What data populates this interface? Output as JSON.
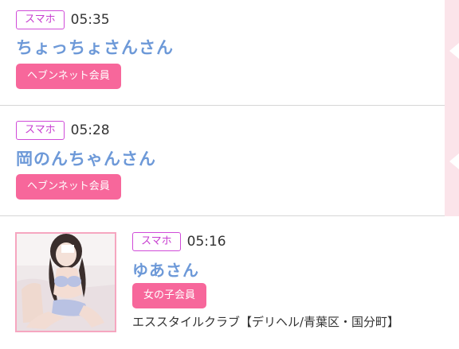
{
  "entries": [
    {
      "device": "スマホ",
      "time": "05:35",
      "name": "ちょっちょさんさん",
      "member": "ヘブンネット会員"
    },
    {
      "device": "スマホ",
      "time": "05:28",
      "name": "岡のんちゃんさん",
      "member": "ヘブンネット会員"
    },
    {
      "device": "スマホ",
      "time": "05:16",
      "name": "ゆあさん",
      "member": "女の子会員",
      "shop": "エススタイルクラブ【デリヘル/青葉区・国分町】"
    }
  ],
  "colors": {
    "name": "#6d99d8",
    "member_badge": "#f7679b",
    "device_badge": "#c73fd0",
    "side_strip": "#fbe4ea"
  }
}
